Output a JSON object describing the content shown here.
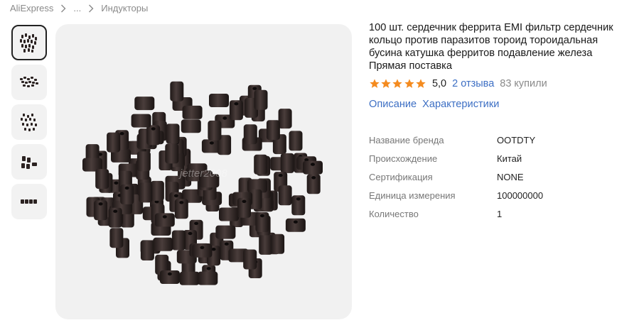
{
  "breadcrumb": {
    "items": [
      "AliExpress",
      "...",
      "Индукторы"
    ]
  },
  "gallery": {
    "thumb_count": 5,
    "active_index": 0,
    "watermark": "jetter2008"
  },
  "product": {
    "title": "100 шт. сердечник феррита EMI фильтр сердечник кольцо против паразитов тороид тороидальная бусина катушка ферритов подавление железа Прямая поставка",
    "rating": {
      "stars": 5,
      "value": "5,0",
      "reviews": "2 отзыва",
      "bought": "83 купили"
    },
    "tabs": [
      "Описание",
      "Характеристики"
    ],
    "specs": [
      {
        "key": "Название бренда",
        "value": "OOTDTY"
      },
      {
        "key": "Происхождение",
        "value": "Китай"
      },
      {
        "key": "Сертификация",
        "value": "NONE"
      },
      {
        "key": "Единица измерения",
        "value": "100000000"
      },
      {
        "key": "Количество",
        "value": "1"
      }
    ]
  },
  "colors": {
    "link": "#3d6fc4",
    "star": "#f48b1f",
    "muted": "#8a8a8a",
    "image_bg": "#f1f1f1",
    "bead": "#2b2221"
  },
  "icons": {
    "breadcrumb_separator": "chevron-right-icon",
    "rating": "star-icon"
  }
}
